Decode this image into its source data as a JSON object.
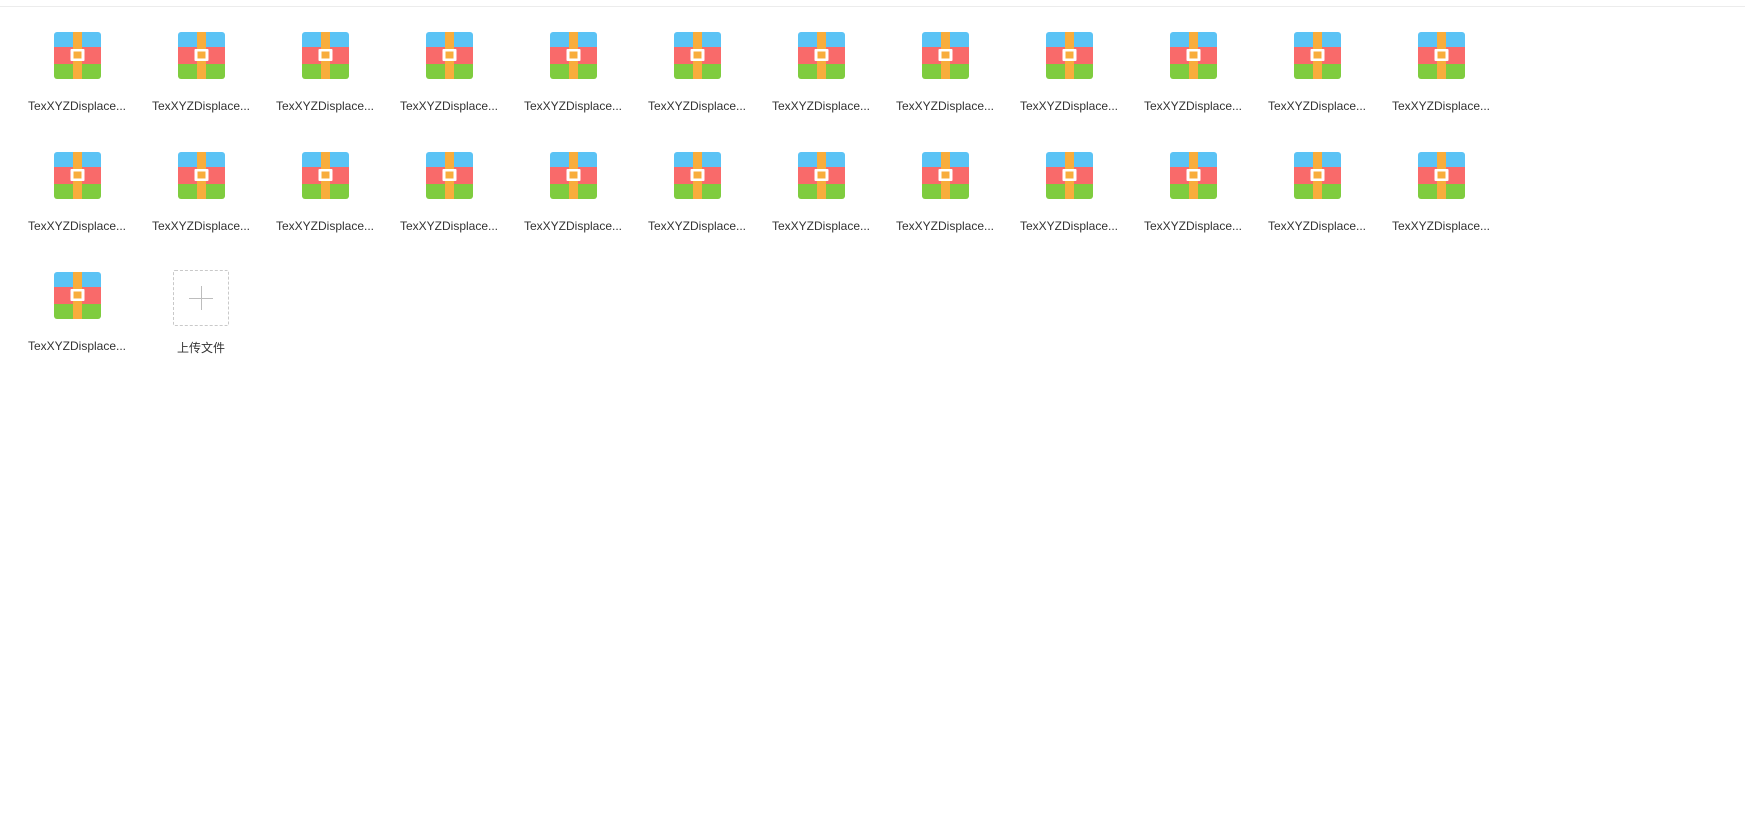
{
  "files": [
    {
      "name": "TexXYZDisplace..."
    },
    {
      "name": "TexXYZDisplace..."
    },
    {
      "name": "TexXYZDisplace..."
    },
    {
      "name": "TexXYZDisplace..."
    },
    {
      "name": "TexXYZDisplace..."
    },
    {
      "name": "TexXYZDisplace..."
    },
    {
      "name": "TexXYZDisplace..."
    },
    {
      "name": "TexXYZDisplace..."
    },
    {
      "name": "TexXYZDisplace..."
    },
    {
      "name": "TexXYZDisplace..."
    },
    {
      "name": "TexXYZDisplace..."
    },
    {
      "name": "TexXYZDisplace..."
    },
    {
      "name": "TexXYZDisplace..."
    },
    {
      "name": "TexXYZDisplace..."
    },
    {
      "name": "TexXYZDisplace..."
    },
    {
      "name": "TexXYZDisplace..."
    },
    {
      "name": "TexXYZDisplace..."
    },
    {
      "name": "TexXYZDisplace..."
    },
    {
      "name": "TexXYZDisplace..."
    },
    {
      "name": "TexXYZDisplace..."
    },
    {
      "name": "TexXYZDisplace..."
    },
    {
      "name": "TexXYZDisplace..."
    },
    {
      "name": "TexXYZDisplace..."
    },
    {
      "name": "TexXYZDisplace..."
    },
    {
      "name": "TexXYZDisplace..."
    }
  ],
  "upload": {
    "label": "上传文件",
    "icon": "plus-icon"
  },
  "icon": {
    "name": "archive-file-icon",
    "colors": {
      "top": "#5bc3f5",
      "middle": "#f96a6a",
      "bottom": "#7fcc3f",
      "strap": "#f8ad3c",
      "buckle": "#ffffff"
    }
  }
}
